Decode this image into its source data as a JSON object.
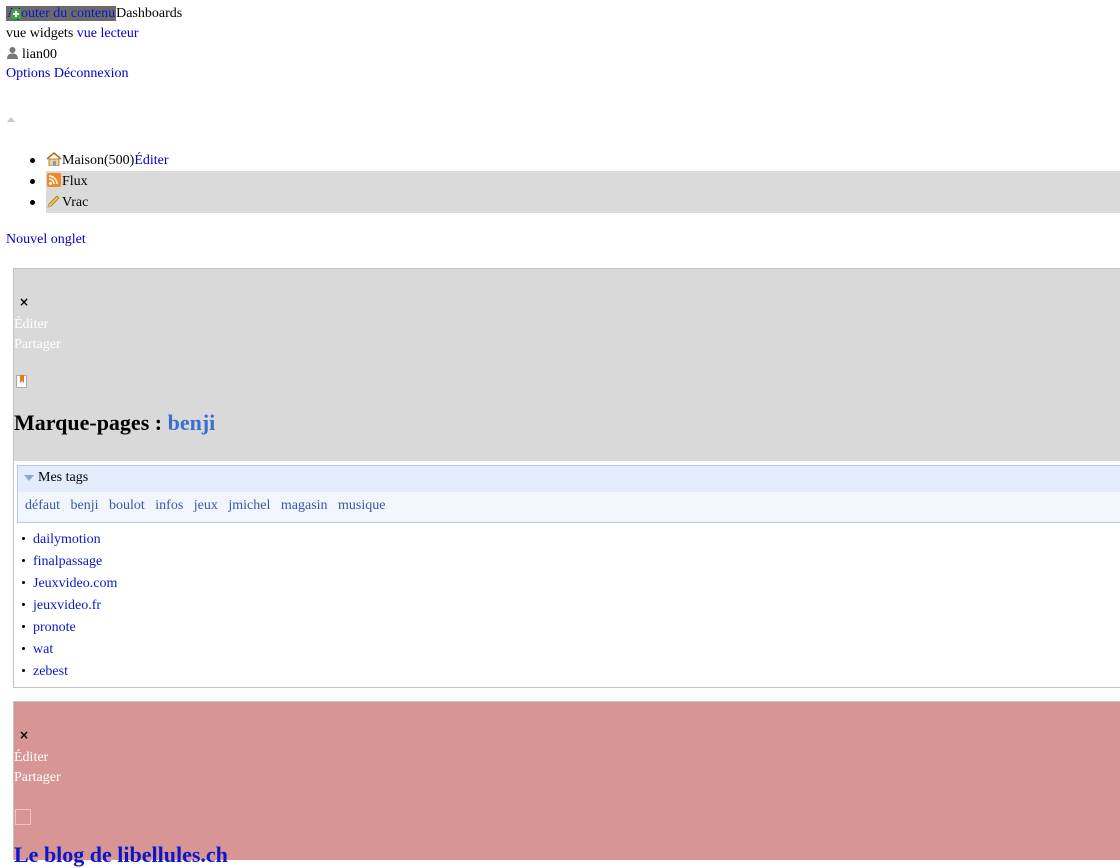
{
  "topbar": {
    "add_content": "Ajouter du contenu",
    "dashboards": "Dashboards",
    "view_widgets": "vue widgets",
    "view_reader": "vue lecteur",
    "username": "lian00",
    "options": "Options",
    "logout": "Déconnexion"
  },
  "tabs": [
    {
      "label": "Maison",
      "count": "(500)",
      "edit": "Éditer",
      "icon": "house-icon"
    },
    {
      "label": "Flux",
      "icon": "rss-icon"
    },
    {
      "label": "Vrac",
      "icon": "pencil-icon"
    }
  ],
  "new_tab": "Nouvel onglet",
  "widget1": {
    "close": "×",
    "edit": "Éditer",
    "share": "Partager",
    "title_prefix": "Marque-pages : ",
    "title_owner": "benji",
    "tags_title": "Mes tags",
    "tags": [
      "défaut",
      "benji",
      "boulot",
      "infos",
      "jeux",
      "jmichel",
      "magasin",
      "musique"
    ],
    "bookmarks": [
      "dailymotion",
      "finalpassage",
      "Jeuxvideo.com",
      "jeuxvideo.fr",
      "pronote",
      "wat",
      "zebest"
    ]
  },
  "widget2": {
    "close": "×",
    "edit": "Éditer",
    "share": "Partager",
    "title": "Le blog de libellules.ch"
  },
  "colors": {
    "tab_inactive_bg": "#dadada",
    "widget1_header_bg": "#d9d9d9",
    "widget2_bg": "#d79595",
    "link": "#0a17c9",
    "owner_accent": "#3a6fcf"
  }
}
